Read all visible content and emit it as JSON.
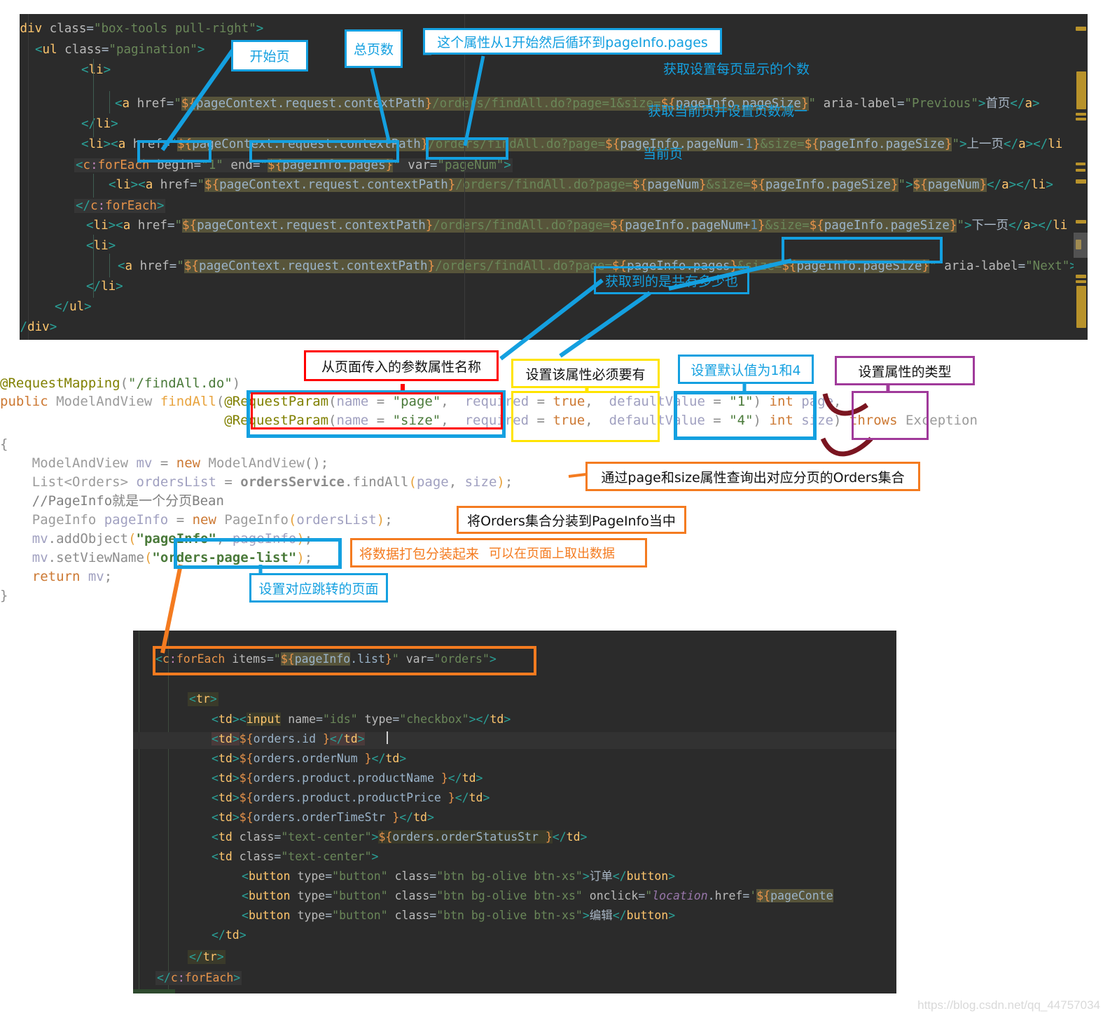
{
  "editors": {
    "top": {
      "lines": [
        "<div class=\"box-tools pull-right\">",
        "    <ul class=\"pagination\">",
        "        <li>",
        "            <a href=\"${pageContext.request.contextPath}/orders/findAll.do?page=1&size=${pageInfo.pageSize}\" aria-label=\"Previous\">首页</a>",
        "        </li>",
        "        <li><a href=\"${pageContext.request.contextPath}/orders/findAll.do?page=${pageInfo.pageNum-1}&size=${pageInfo.pageSize}\">上一页</a></li>",
        "    <c:forEach begin=\"1\" end=\"${pageInfo.pages}\" var=\"pageNum\">",
        "        <li><a href=\"${pageContext.request.contextPath}/orders/findAll.do?page=${pageNum}&size=${pageInfo.pageSize}\">${pageNum}</a></li>",
        "    </c:forEach>",
        "        <li><a href=\"${pageContext.request.contextPath}/orders/findAll.do?page=${pageInfo.pageNum+1}&size=${pageInfo.pageSize}\">下一页</a></li>",
        "        <li>",
        "            <a href=\"${pageContext.request.contextPath}/orders/findAll.do?page=${pageInfo.pages}&size=${pageInfo.pageSize}\" aria-label=\"Next\">",
        "        </li>",
        "    </ul>",
        "</div>"
      ]
    },
    "middle": {
      "lines": [
        "@RequestMapping(\"/findAll.do\")",
        "public ModelAndView findAll(@RequestParam(name = \"page\", required = true, defaultValue = \"1\") int page,",
        "                            @RequestParam(name = \"size\", required = true, defaultValue = \"4\") int size) throws Exception",
        "{",
        "    ModelAndView mv = new ModelAndView();",
        "    List<Orders> ordersList = ordersService.findAll(page, size);",
        "    //PageInfo就是一个分页Bean",
        "    PageInfo pageInfo = new PageInfo(ordersList);",
        "    mv.addObject(\"pageInfo\", pageInfo);",
        "    mv.setViewName(\"orders-page-list\");",
        "    return mv;",
        "}"
      ]
    },
    "bottom": {
      "lines": [
        "<c:forEach items=\"${pageInfo.list}\" var=\"orders\">",
        "",
        "    <tr>",
        "        <td><input name=\"ids\" type=\"checkbox\"></td>",
        "        <td>${orders.id }</td>",
        "        <td>${orders.orderNum }</td>",
        "        <td>${orders.product.productName }</td>",
        "        <td>${orders.product.productPrice }</td>",
        "        <td>${orders.orderTimeStr }</td>",
        "        <td class=\"text-center\">${orders.orderStatusStr }</td>",
        "        <td class=\"text-center\">",
        "            <button type=\"button\" class=\"btn bg-olive btn-xs\">订单</button>",
        "            <button type=\"button\" class=\"btn bg-olive btn-xs\" onclick=\"location.href='${pageConte",
        "            <button type=\"button\" class=\"btn bg-olive btn-xs\">编辑</button>",
        "        </td>",
        "    </tr>",
        "</c:forEach>"
      ]
    }
  },
  "annotations": {
    "start_page": "开始页",
    "total_pages": "总页数",
    "loop_from_one": "这个属性从1开始然后循环到pageInfo.pages",
    "page_size_get": "获取设置每页显示的个数",
    "current_page_minus_one": "获取当前页并设置页数减一",
    "current_page": "当前页",
    "total_count": "获取到的是共有多少也",
    "param_name_from_page": "从页面传入的参数属性名称",
    "required_must": "设置该属性必须要有",
    "default_values": "设置默认值为1和4",
    "attr_type": "设置属性的类型",
    "query_orders_by_page_size": "通过page和size属性查询出对应分页的Orders集合",
    "wrap_orders_into_pageinfo": "将Orders集合分装到PageInfo当中",
    "pack_data": "将数据打包分装起来",
    "can_fetch_on_page": "可以在页面上取出数据",
    "set_jump_page": "设置对应跳转的页面"
  },
  "colors": {
    "blue": "#14a0e0",
    "red": "#ff0000",
    "yellow": "#ffe400",
    "purple": "#a03a9a",
    "orange": "#f47b20",
    "dark_red_arrow": "#7a1520",
    "editor_bg": "#2b2b2b",
    "page_bg": "#ffffff"
  },
  "watermark": "https://blog.csdn.net/qq_44757034"
}
